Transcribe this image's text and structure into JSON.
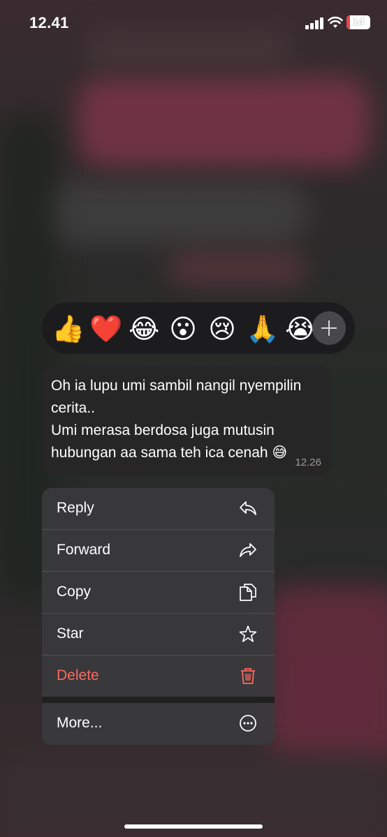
{
  "status_bar": {
    "time": "12.41",
    "battery_level": "14",
    "battery_fraction": 0.14
  },
  "reactions": [
    {
      "emoji": "👍",
      "icon": "thumbs-up-icon"
    },
    {
      "emoji": "❤️",
      "icon": "red-heart-icon"
    },
    {
      "emoji": "😂",
      "icon": "tears-of-joy-icon"
    },
    {
      "emoji": "😮",
      "icon": "face-open-mouth-icon"
    },
    {
      "emoji": "😢",
      "icon": "crying-face-icon"
    },
    {
      "emoji": "🙏",
      "icon": "folded-hands-icon"
    },
    {
      "emoji": "😭",
      "icon": "loudly-crying-face-icon"
    }
  ],
  "message": {
    "text": "Oh ia lupu umi sambil nangil nyempilin\ncerita..\nUmi merasa berdosa juga mutusin\nhubungan aa sama teh ica cenah 😅",
    "time": "12.26"
  },
  "menu": {
    "reply": "Reply",
    "forward": "Forward",
    "copy": "Copy",
    "star": "Star",
    "delete": "Delete",
    "more": "More..."
  },
  "colors": {
    "danger": "#ff6961",
    "menu_bg": "#3a3a3c",
    "bubble_bg": "#262626"
  }
}
